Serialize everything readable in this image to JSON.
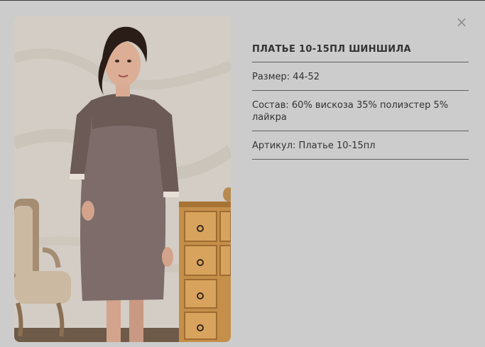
{
  "modal": {
    "close_symbol": "×",
    "image": {
      "icon": "product-photo",
      "background_color": "#cccccc"
    }
  },
  "product": {
    "title": "ПЛАТЬЕ 10-15ПЛ ШИНШИЛА",
    "size_label": "Размер:",
    "size_value": "44-52",
    "composition_label": "Состав:",
    "composition_value": "60% вискоза 35% полиэстер 5% лайкра",
    "article_label": "Артикул:",
    "article_value": "Платье 10-15пл"
  },
  "colors": {
    "divider": "#5f5f5f",
    "dress": "#7d6c69",
    "close": "#8f8f8f"
  }
}
